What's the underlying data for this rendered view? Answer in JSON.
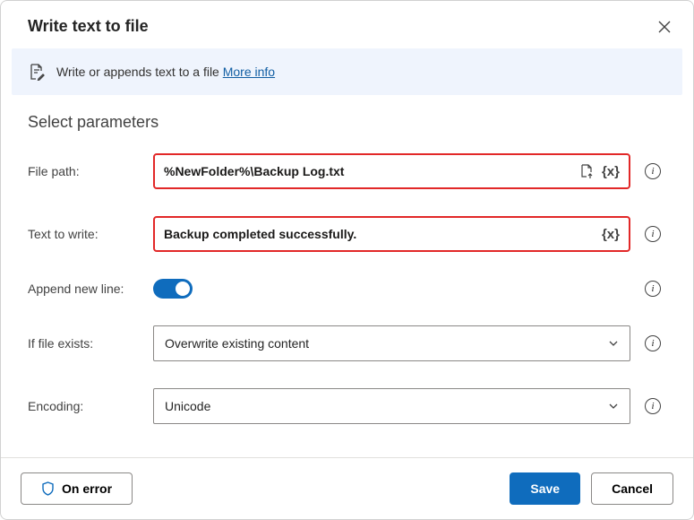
{
  "header": {
    "title": "Write text to file"
  },
  "banner": {
    "text": "Write or appends text to a file ",
    "link_label": "More info"
  },
  "section": {
    "title": "Select parameters"
  },
  "fields": {
    "filepath": {
      "label": "File path:",
      "value": "%NewFolder%\\Backup Log.txt"
    },
    "text": {
      "label": "Text to write:",
      "value": "Backup completed successfully."
    },
    "append": {
      "label": "Append new line:"
    },
    "exists": {
      "label": "If file exists:",
      "value": "Overwrite existing content"
    },
    "encoding": {
      "label": "Encoding:",
      "value": "Unicode"
    }
  },
  "footer": {
    "on_error": "On error",
    "save": "Save",
    "cancel": "Cancel"
  }
}
